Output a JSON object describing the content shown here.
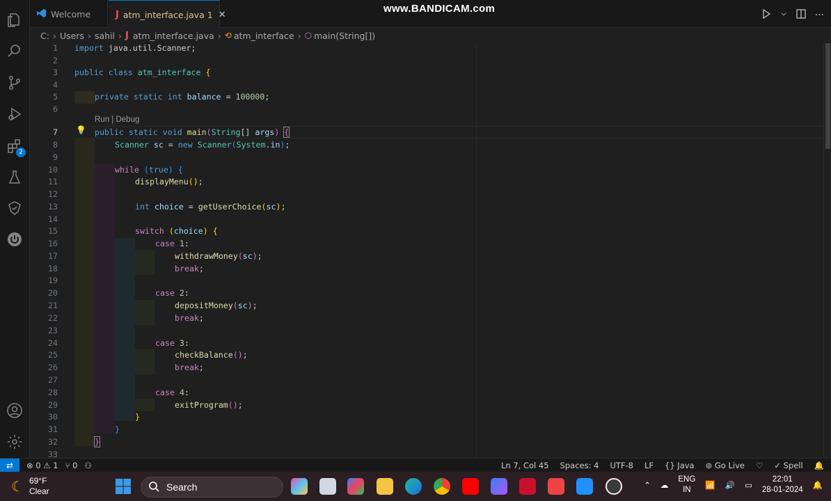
{
  "watermark": "www.BANDICAM.com",
  "tabs": [
    {
      "label": "Welcome"
    },
    {
      "label": "atm_interface.java",
      "modified_count": "1"
    }
  ],
  "breadcrumb": [
    "C:",
    "Users",
    "sahil",
    "atm_interface.java",
    "atm_interface",
    "main(String[])"
  ],
  "editor": {
    "codelens": "Run | Debug",
    "active_line": "7",
    "line_numbers": [
      "1",
      "2",
      "3",
      "4",
      "5",
      "6",
      "7",
      "8",
      "9",
      "10",
      "11",
      "12",
      "13",
      "14",
      "15",
      "16",
      "17",
      "18",
      "19",
      "20",
      "21",
      "22",
      "23",
      "24",
      "25",
      "26",
      "27",
      "28",
      "29",
      "30",
      "31",
      "32",
      "33"
    ],
    "code": {
      "l1a": "import",
      "l1b": " java.util.Scanner;",
      "l3a": "public",
      "l3b": "class",
      "l3c": "atm_interface",
      "l3d": "{",
      "l5a": "private",
      "l5b": "static",
      "l5c": "int",
      "l5d": "balance",
      "l5e": " = ",
      "l5f": "100000",
      "l5g": ";",
      "l7a": "public",
      "l7b": "static",
      "l7c": "void",
      "l7d": "main",
      "l7e": "(",
      "l7f": "String",
      "l7g": "[] ",
      "l7h": "args",
      "l7i": ")",
      "l7j": "{",
      "l8a": "Scanner",
      "l8b": "sc",
      "l8c": " = ",
      "l8d": "new",
      "l8e": "Scanner",
      "l8f": "(",
      "l8g": "System",
      "l8h": ".",
      "l8i": "in",
      "l8j": ")",
      "l8k": ";",
      "l10a": "while",
      "l10b": "(",
      "l10c": "true",
      "l10d": ")",
      "l10e": "{",
      "l11a": "displayMenu",
      "l11b": "()",
      "l11c": ";",
      "l13a": "int",
      "l13b": "choice",
      "l13c": " = ",
      "l13d": "getUserChoice",
      "l13e": "(",
      "l13f": "sc",
      "l13g": ")",
      "l13h": ";",
      "l15a": "switch",
      "l15b": "(",
      "l15c": "choice",
      "l15d": ")",
      "l15e": "{",
      "l16a": "case",
      "l16b": "1",
      "l16c": ":",
      "l17a": "withdrawMoney",
      "l17b": "(",
      "l17c": "sc",
      "l17d": ")",
      "l17e": ";",
      "l18a": "break",
      "l18b": ";",
      "l20a": "case",
      "l20b": "2",
      "l20c": ":",
      "l21a": "depositMoney",
      "l21b": "(",
      "l21c": "sc",
      "l21d": ")",
      "l21e": ";",
      "l22a": "break",
      "l22b": ";",
      "l24a": "case",
      "l24b": "3",
      "l24c": ":",
      "l25a": "checkBalance",
      "l25b": "()",
      "l25c": ";",
      "l26a": "break",
      "l26b": ";",
      "l28a": "case",
      "l28b": "4",
      "l28c": ":",
      "l29a": "exitProgram",
      "l29b": "()",
      "l29c": ";",
      "l30a": "}",
      "l31a": "}",
      "l32a": "}"
    }
  },
  "statusbar": {
    "errors": "0",
    "warnings": "1",
    "ports": "0",
    "position": "Ln 7, Col 45",
    "spaces": "Spaces: 4",
    "encoding": "UTF-8",
    "eol": "LF",
    "language": "Java",
    "golive": "Go Live",
    "spell": "Spell"
  },
  "taskbar": {
    "temp": "69°F",
    "condition": "Clear",
    "search_placeholder": "Search",
    "lang_top": "ENG",
    "lang_bottom": "IN",
    "time": "22:01",
    "date": "28-01-2024"
  },
  "colors": {
    "accent": "#0078d4",
    "keyword": "#569cd6",
    "control": "#c586c0",
    "type": "#4ec9b0",
    "variable": "#9cdcfe",
    "function": "#dcdcaa",
    "number": "#b5cea8"
  }
}
